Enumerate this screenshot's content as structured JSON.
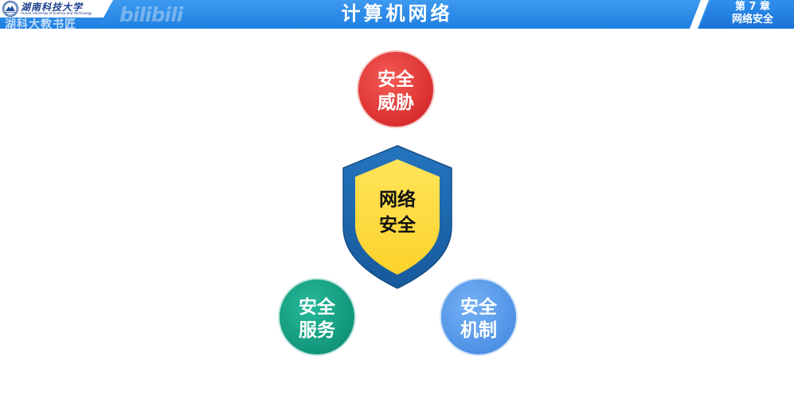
{
  "header": {
    "university_name": "湖南科技大学",
    "university_name_en": "Hunan University of Science and Technology",
    "title": "计算机网络",
    "chapter_label": "第 7 章",
    "chapter_title": "网络安全"
  },
  "watermark": {
    "channel": "湖科大教书匠",
    "platform": "bilibili"
  },
  "diagram": {
    "center": {
      "line1": "网络",
      "line2": "安全"
    },
    "top": {
      "line1": "安全",
      "line2": "威胁"
    },
    "bottom_left": {
      "line1": "安全",
      "line2": "服务"
    },
    "bottom_right": {
      "line1": "安全",
      "line2": "机制"
    }
  },
  "colors": {
    "header_blue": "#1f7fe0",
    "threat_red": "#e53935",
    "service_teal": "#16a386",
    "mechanism_blue": "#5a9ced",
    "shield_outer": "#1e68ad",
    "shield_inner": "#fdd835"
  },
  "icons": {
    "logo": "university-emblem-icon"
  }
}
